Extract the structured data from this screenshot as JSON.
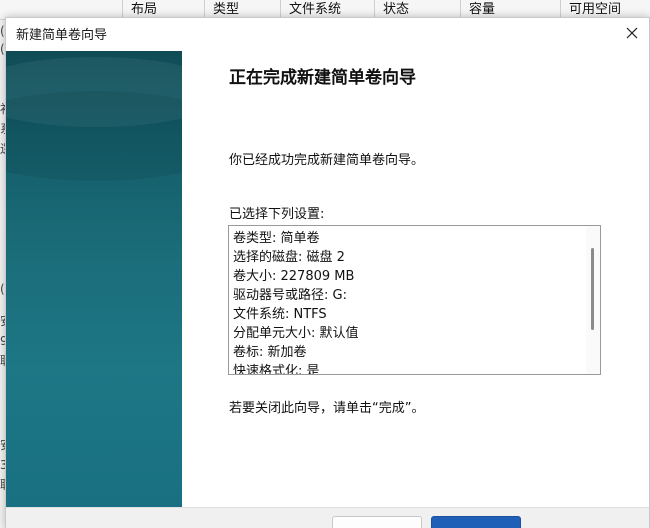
{
  "background": {
    "columns": [
      "布局",
      "类型",
      "文件系统",
      "状态",
      "容量",
      "可用空间"
    ],
    "left_fragments": [
      "(",
      "(",
      "补",
      "系",
      "逻",
      "(",
      "安",
      "9",
      "联",
      "安",
      "3",
      "联"
    ]
  },
  "dialog": {
    "title": "新建简单卷向导",
    "heading": "正在完成新建简单卷向导",
    "completed_message": "你已经成功完成新建简单卷向导。",
    "settings_label": "已选择下列设置:",
    "settings": [
      "卷类型: 简单卷",
      "选择的磁盘: 磁盘 2",
      "卷大小: 227809 MB",
      "驱动器号或路径: G:",
      "文件系统: NTFS",
      "分配单元大小: 默认值",
      "卷标: 新加卷",
      "快速格式化: 是"
    ],
    "close_hint": "若要关闭此向导，请单击“完成”。"
  },
  "colors": {
    "side_panel": "#135c68",
    "primary_button": "#1f5fb8"
  },
  "icons": {
    "close": "close-icon"
  }
}
